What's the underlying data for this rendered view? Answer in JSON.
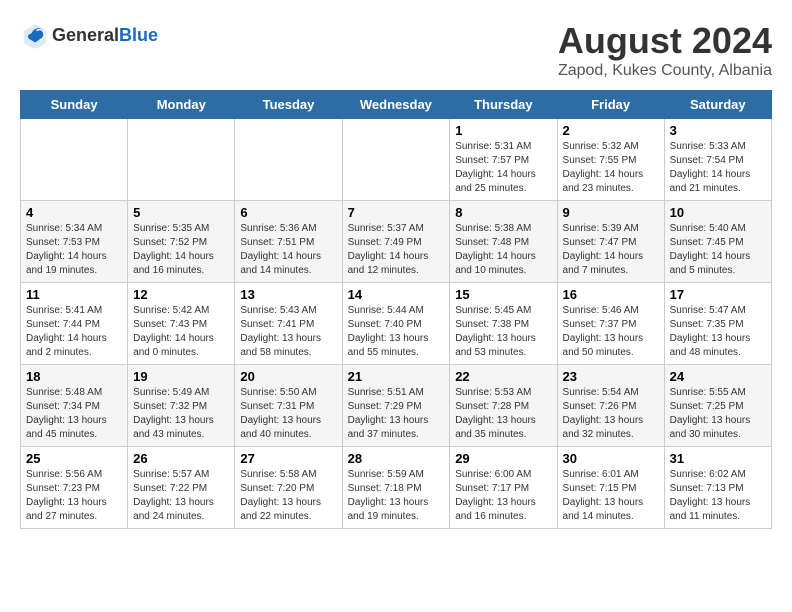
{
  "header": {
    "logo_general": "General",
    "logo_blue": "Blue",
    "main_title": "August 2024",
    "subtitle": "Zapod, Kukes County, Albania"
  },
  "weekdays": [
    "Sunday",
    "Monday",
    "Tuesday",
    "Wednesday",
    "Thursday",
    "Friday",
    "Saturday"
  ],
  "weeks": [
    [
      {
        "day": "",
        "info": ""
      },
      {
        "day": "",
        "info": ""
      },
      {
        "day": "",
        "info": ""
      },
      {
        "day": "",
        "info": ""
      },
      {
        "day": "1",
        "info": "Sunrise: 5:31 AM\nSunset: 7:57 PM\nDaylight: 14 hours and 25 minutes."
      },
      {
        "day": "2",
        "info": "Sunrise: 5:32 AM\nSunset: 7:55 PM\nDaylight: 14 hours and 23 minutes."
      },
      {
        "day": "3",
        "info": "Sunrise: 5:33 AM\nSunset: 7:54 PM\nDaylight: 14 hours and 21 minutes."
      }
    ],
    [
      {
        "day": "4",
        "info": "Sunrise: 5:34 AM\nSunset: 7:53 PM\nDaylight: 14 hours and 19 minutes."
      },
      {
        "day": "5",
        "info": "Sunrise: 5:35 AM\nSunset: 7:52 PM\nDaylight: 14 hours and 16 minutes."
      },
      {
        "day": "6",
        "info": "Sunrise: 5:36 AM\nSunset: 7:51 PM\nDaylight: 14 hours and 14 minutes."
      },
      {
        "day": "7",
        "info": "Sunrise: 5:37 AM\nSunset: 7:49 PM\nDaylight: 14 hours and 12 minutes."
      },
      {
        "day": "8",
        "info": "Sunrise: 5:38 AM\nSunset: 7:48 PM\nDaylight: 14 hours and 10 minutes."
      },
      {
        "day": "9",
        "info": "Sunrise: 5:39 AM\nSunset: 7:47 PM\nDaylight: 14 hours and 7 minutes."
      },
      {
        "day": "10",
        "info": "Sunrise: 5:40 AM\nSunset: 7:45 PM\nDaylight: 14 hours and 5 minutes."
      }
    ],
    [
      {
        "day": "11",
        "info": "Sunrise: 5:41 AM\nSunset: 7:44 PM\nDaylight: 14 hours and 2 minutes."
      },
      {
        "day": "12",
        "info": "Sunrise: 5:42 AM\nSunset: 7:43 PM\nDaylight: 14 hours and 0 minutes."
      },
      {
        "day": "13",
        "info": "Sunrise: 5:43 AM\nSunset: 7:41 PM\nDaylight: 13 hours and 58 minutes."
      },
      {
        "day": "14",
        "info": "Sunrise: 5:44 AM\nSunset: 7:40 PM\nDaylight: 13 hours and 55 minutes."
      },
      {
        "day": "15",
        "info": "Sunrise: 5:45 AM\nSunset: 7:38 PM\nDaylight: 13 hours and 53 minutes."
      },
      {
        "day": "16",
        "info": "Sunrise: 5:46 AM\nSunset: 7:37 PM\nDaylight: 13 hours and 50 minutes."
      },
      {
        "day": "17",
        "info": "Sunrise: 5:47 AM\nSunset: 7:35 PM\nDaylight: 13 hours and 48 minutes."
      }
    ],
    [
      {
        "day": "18",
        "info": "Sunrise: 5:48 AM\nSunset: 7:34 PM\nDaylight: 13 hours and 45 minutes."
      },
      {
        "day": "19",
        "info": "Sunrise: 5:49 AM\nSunset: 7:32 PM\nDaylight: 13 hours and 43 minutes."
      },
      {
        "day": "20",
        "info": "Sunrise: 5:50 AM\nSunset: 7:31 PM\nDaylight: 13 hours and 40 minutes."
      },
      {
        "day": "21",
        "info": "Sunrise: 5:51 AM\nSunset: 7:29 PM\nDaylight: 13 hours and 37 minutes."
      },
      {
        "day": "22",
        "info": "Sunrise: 5:53 AM\nSunset: 7:28 PM\nDaylight: 13 hours and 35 minutes."
      },
      {
        "day": "23",
        "info": "Sunrise: 5:54 AM\nSunset: 7:26 PM\nDaylight: 13 hours and 32 minutes."
      },
      {
        "day": "24",
        "info": "Sunrise: 5:55 AM\nSunset: 7:25 PM\nDaylight: 13 hours and 30 minutes."
      }
    ],
    [
      {
        "day": "25",
        "info": "Sunrise: 5:56 AM\nSunset: 7:23 PM\nDaylight: 13 hours and 27 minutes."
      },
      {
        "day": "26",
        "info": "Sunrise: 5:57 AM\nSunset: 7:22 PM\nDaylight: 13 hours and 24 minutes."
      },
      {
        "day": "27",
        "info": "Sunrise: 5:58 AM\nSunset: 7:20 PM\nDaylight: 13 hours and 22 minutes."
      },
      {
        "day": "28",
        "info": "Sunrise: 5:59 AM\nSunset: 7:18 PM\nDaylight: 13 hours and 19 minutes."
      },
      {
        "day": "29",
        "info": "Sunrise: 6:00 AM\nSunset: 7:17 PM\nDaylight: 13 hours and 16 minutes."
      },
      {
        "day": "30",
        "info": "Sunrise: 6:01 AM\nSunset: 7:15 PM\nDaylight: 13 hours and 14 minutes."
      },
      {
        "day": "31",
        "info": "Sunrise: 6:02 AM\nSunset: 7:13 PM\nDaylight: 13 hours and 11 minutes."
      }
    ]
  ]
}
